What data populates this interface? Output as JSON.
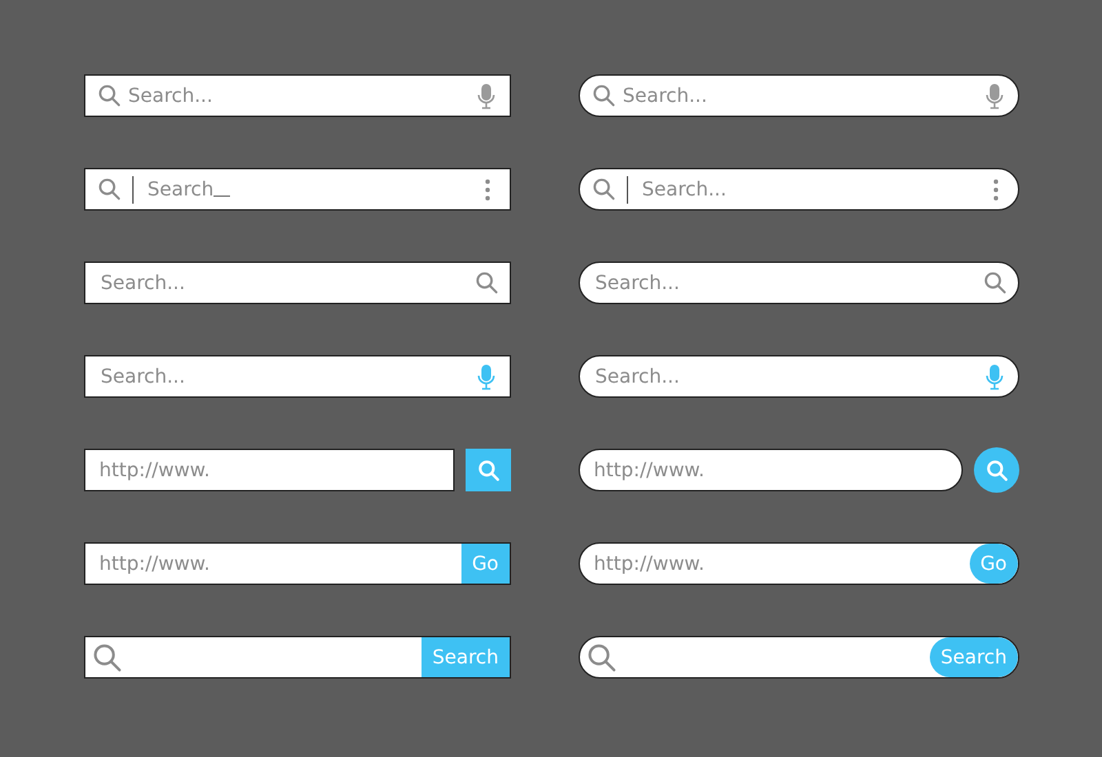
{
  "columns": [
    {
      "kind": "square",
      "bars": [
        {
          "kind": "mic",
          "placeholder": "Search..."
        },
        {
          "kind": "menu",
          "value": "Search",
          "caret": true
        },
        {
          "kind": "trailing-search",
          "placeholder": "Search..."
        },
        {
          "kind": "voice",
          "placeholder": "Search..."
        },
        {
          "kind": "icon-button",
          "placeholder": "http://www."
        },
        {
          "kind": "text-button",
          "placeholder": "http://www.",
          "button": "Go"
        },
        {
          "kind": "icon-text-button",
          "button": "Search"
        }
      ]
    },
    {
      "kind": "round",
      "bars": [
        {
          "kind": "mic",
          "placeholder": "Search..."
        },
        {
          "kind": "menu",
          "placeholder": "Search..."
        },
        {
          "kind": "trailing-search",
          "placeholder": "Search..."
        },
        {
          "kind": "voice",
          "placeholder": "Search..."
        },
        {
          "kind": "icon-button",
          "placeholder": "http://www."
        },
        {
          "kind": "text-button",
          "placeholder": "http://www.",
          "button": "Go"
        },
        {
          "kind": "icon-text-button",
          "button": "Search"
        }
      ]
    }
  ]
}
